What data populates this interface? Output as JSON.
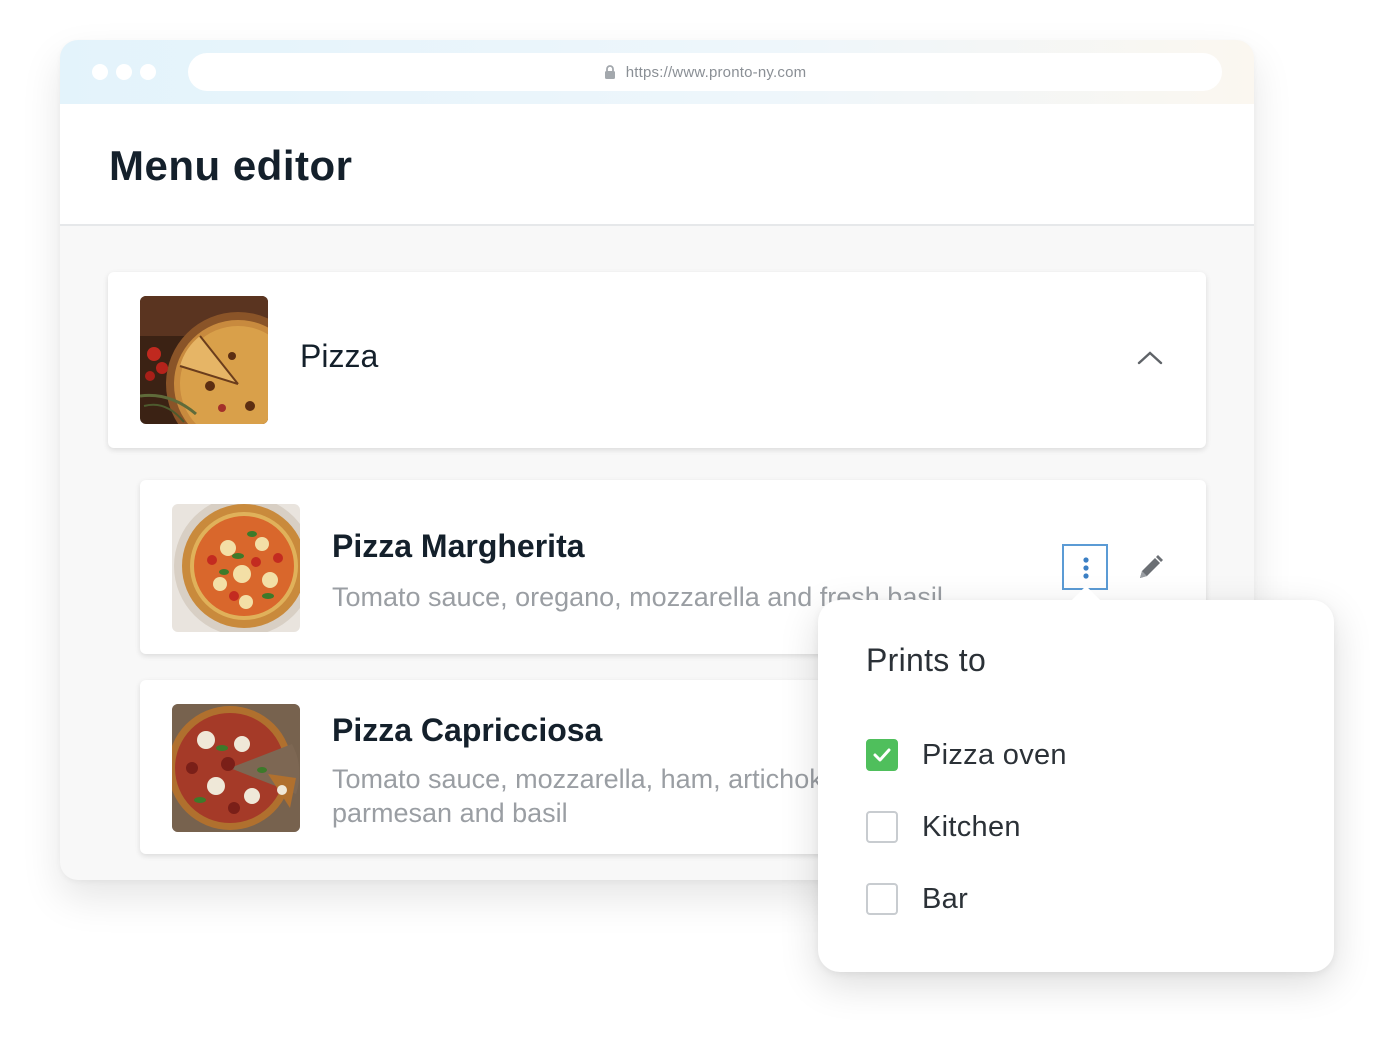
{
  "browser": {
    "url": "https://www.pronto-ny.com"
  },
  "page": {
    "title": "Menu editor"
  },
  "category": {
    "name": "Pizza",
    "image": "pizza-category-photo",
    "expanded": true
  },
  "items": [
    {
      "name": "Pizza Margherita",
      "description": "Tomato sauce, oregano, mozzarella and fresh basil",
      "image": "pizza-margherita-photo"
    },
    {
      "name": "Pizza Capricciosa",
      "description": "Tomato sauce, mozzarella, ham, artichokes, parmesan and basil",
      "image": "pizza-capricciosa-photo"
    }
  ],
  "popover": {
    "title": "Prints to",
    "options": [
      {
        "label": "Pizza oven",
        "checked": true
      },
      {
        "label": "Kitchen",
        "checked": false
      },
      {
        "label": "Bar",
        "checked": false
      }
    ]
  },
  "colors": {
    "accent_check": "#4fbf5c",
    "focus_outline": "#5b9bd5",
    "title_text": "#14202b",
    "muted_text": "#9a9ea3"
  },
  "icons": {
    "lock": "lock-icon",
    "chevron": "chevron-up-icon",
    "more": "more-vertical-icon",
    "edit": "pencil-icon",
    "check": "checkmark-icon"
  }
}
